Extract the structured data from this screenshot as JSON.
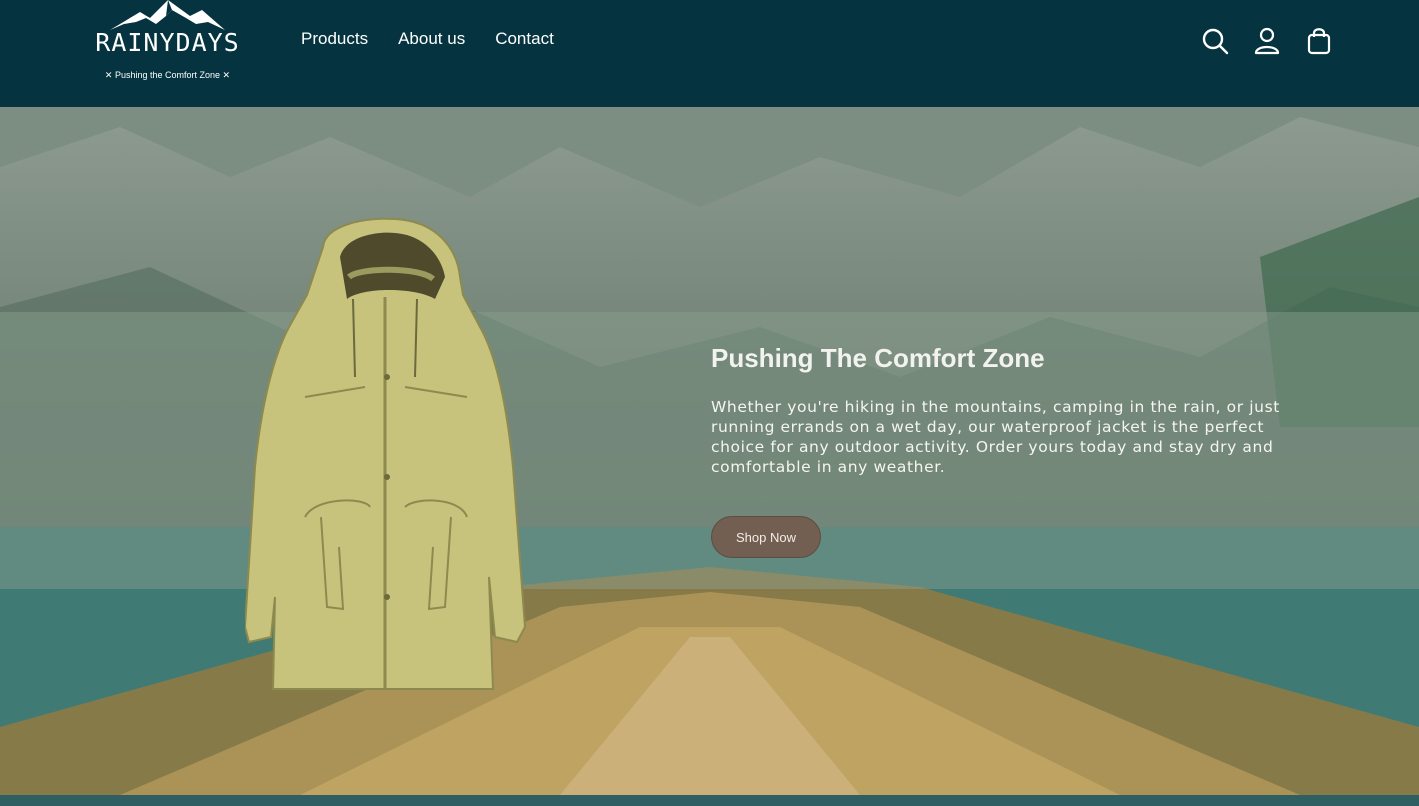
{
  "brand": {
    "name": "RAINYDAYS",
    "tagline": "✕ Pushing the Comfort Zone ✕"
  },
  "nav": {
    "items": [
      "Products",
      "About us",
      "Contact"
    ]
  },
  "header_icons": [
    "search-icon",
    "user-icon",
    "cart-icon"
  ],
  "hero": {
    "title": "Pushing The Comfort Zone",
    "text": "Whether you're hiking in the mountains, camping in the rain, or just running errands on a wet day, our waterproof jacket is the perfect choice for any outdoor activity. Order yours today and stay dry and comfortable in any weather.",
    "button_label": "Shop Now"
  },
  "colors": {
    "header_bg": "#053440",
    "button_bg": "#725f51",
    "text_light": "#ffffff"
  }
}
